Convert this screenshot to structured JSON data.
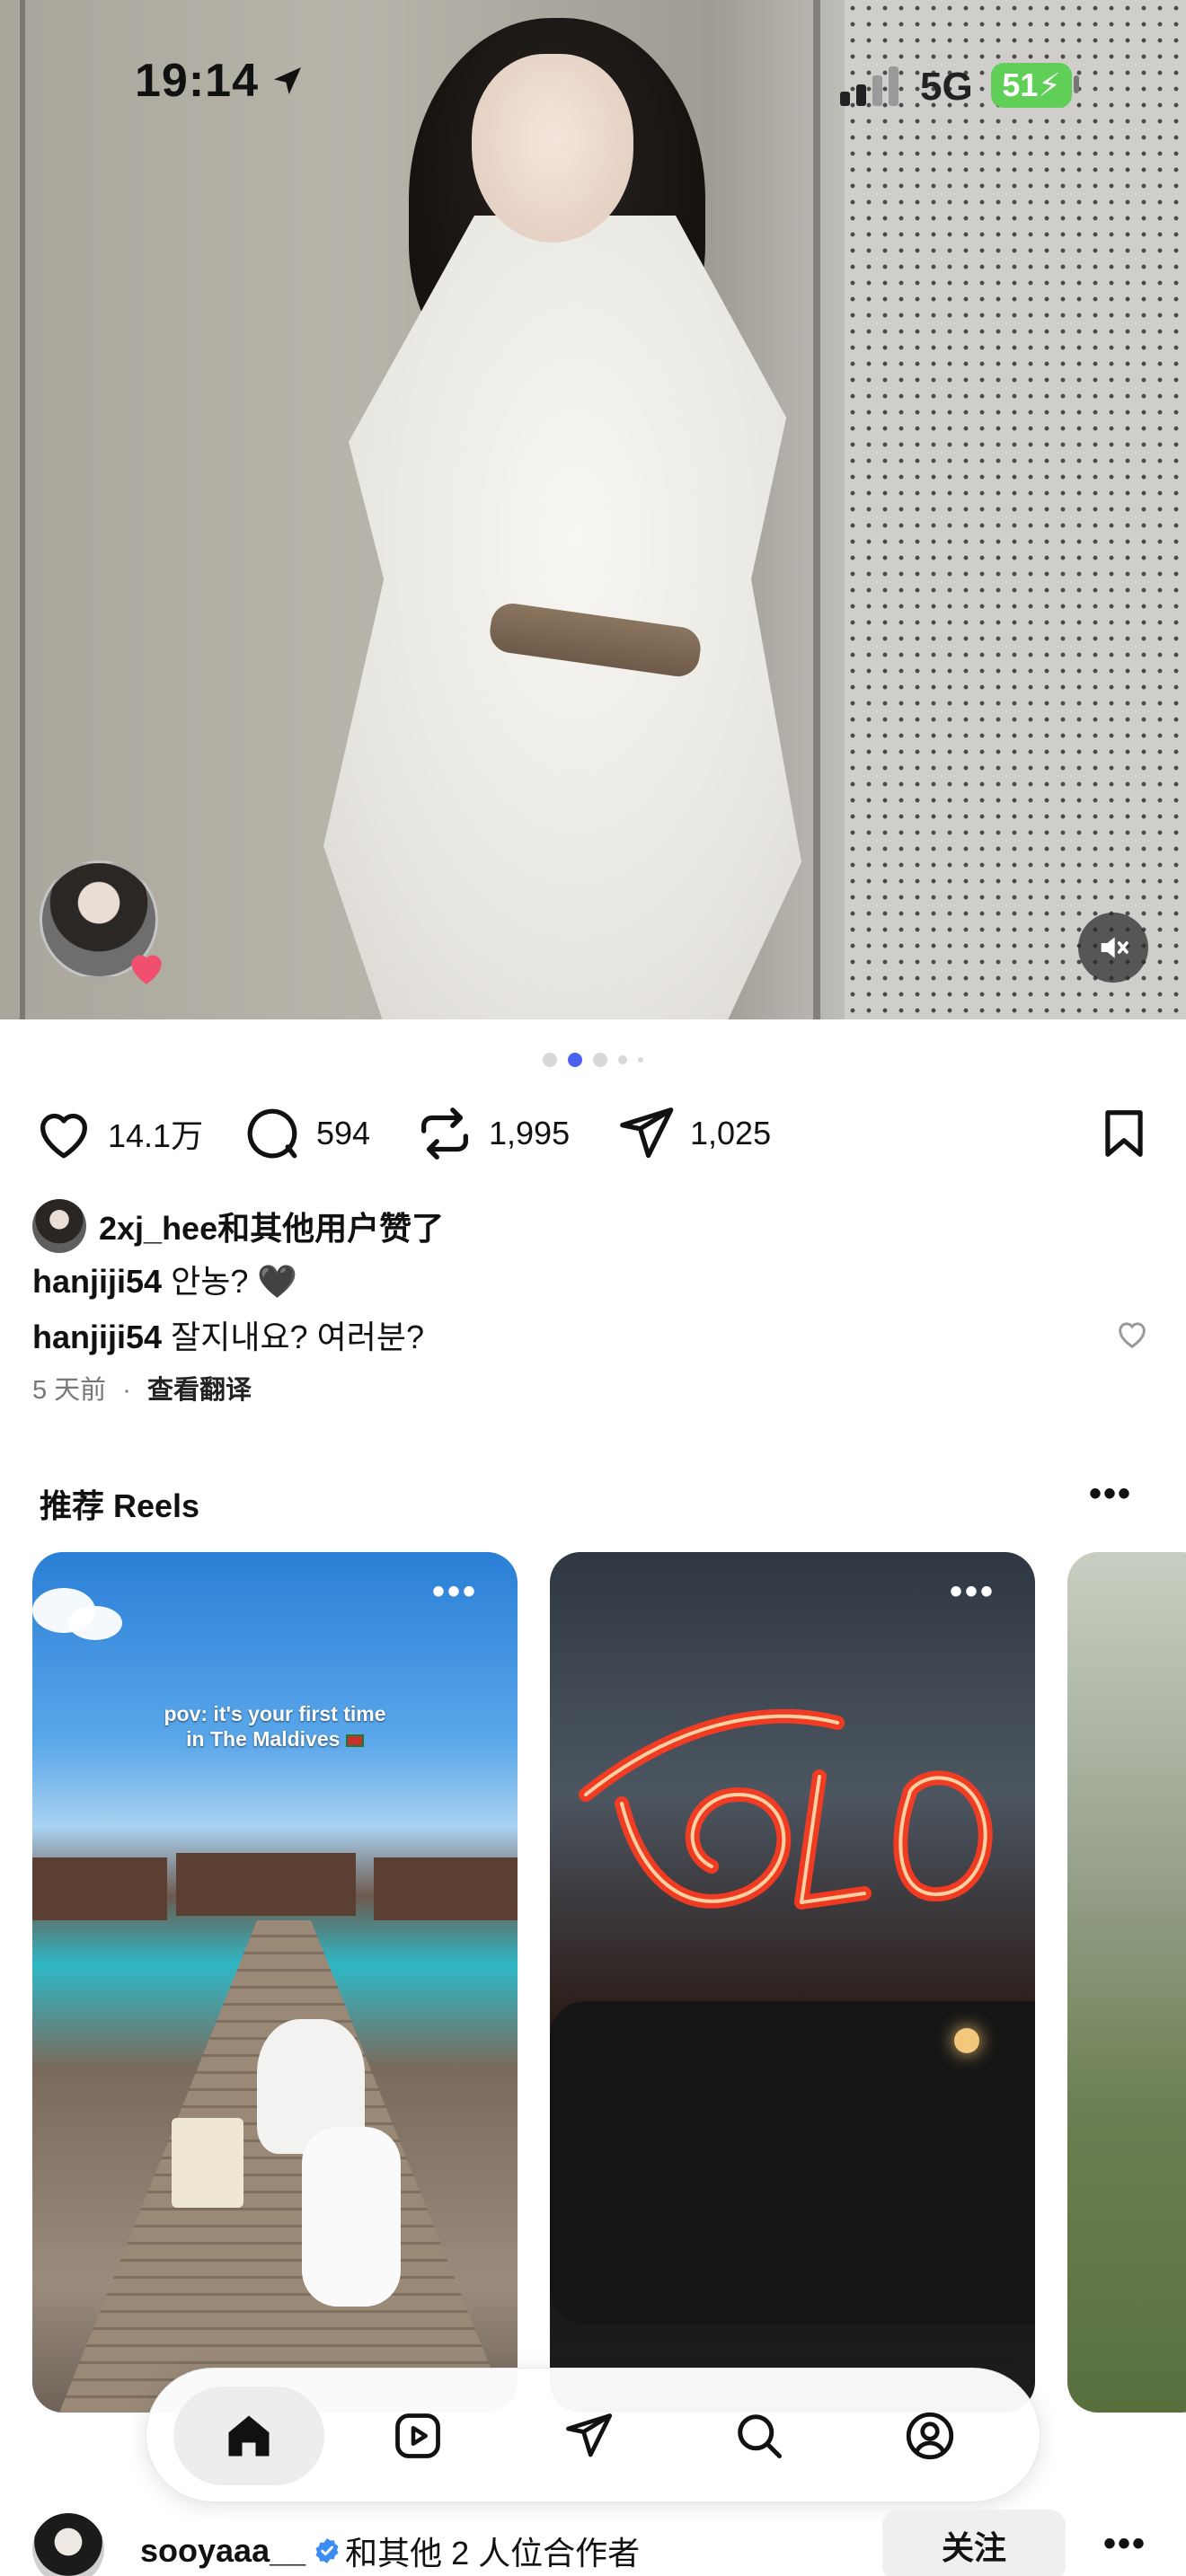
{
  "status_bar": {
    "time": "19:14",
    "network": "5G",
    "battery": "51"
  },
  "post": {
    "carousel": {
      "total": 5,
      "active_index": 1
    },
    "actions": {
      "likes": "14.1万",
      "comments": "594",
      "reposts": "1,995",
      "shares": "1,025"
    },
    "liked_by": {
      "user": "2xj_hee",
      "suffix": "和其他用户赞了"
    },
    "captions": [
      {
        "user": "hanjiji54",
        "text": "안농? 🖤"
      },
      {
        "user": "hanjiji54",
        "text": "잘지내요? 여러분?"
      }
    ],
    "meta": {
      "time_ago": "5 天前",
      "separator": "·",
      "translate": "查看翻译"
    }
  },
  "suggested_reels": {
    "title": "推荐 Reels",
    "more": "•••",
    "reels": [
      {
        "caption_line1": "pov: it's your first time",
        "caption_line2": "in The Maldives",
        "more": "•••"
      },
      {
        "caption_line1": "",
        "caption_line2": "",
        "more": "•••"
      }
    ]
  },
  "bottom_nav": {
    "items": [
      {
        "name": "home",
        "icon": "home-icon",
        "active": true
      },
      {
        "name": "reels",
        "icon": "reels-icon",
        "active": false
      },
      {
        "name": "direct",
        "icon": "send-icon",
        "active": false
      },
      {
        "name": "search",
        "icon": "search-icon",
        "active": false
      },
      {
        "name": "profile",
        "icon": "profile-icon",
        "active": false
      }
    ]
  },
  "next_post": {
    "user": "sooyaaa__",
    "collab_text": "和其他 2 人位合作者",
    "follow_label": "关注",
    "more": "•••"
  },
  "colors": {
    "accent": "#4a62f0",
    "verified": "#3b8cf5",
    "battery": "#5fcf57",
    "heart": "#f0506e"
  }
}
